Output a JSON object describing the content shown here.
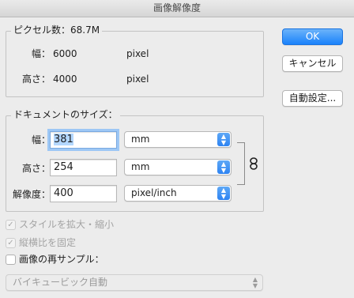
{
  "window": {
    "title": "画像解像度"
  },
  "pixel_dimensions": {
    "title": "ピクセル数：68.7M",
    "width_label": "幅：",
    "width_value": "6000",
    "width_unit": "pixel",
    "height_label": "高さ：",
    "height_value": "4000",
    "height_unit": "pixel"
  },
  "buttons": {
    "ok": "OK",
    "cancel": "キャンセル",
    "auto": "自動設定..."
  },
  "document_size": {
    "title": "ドキュメントのサイズ：",
    "width_label": "幅：",
    "width_value": "381",
    "width_unit": "mm",
    "height_label": "高さ：",
    "height_value": "254",
    "height_unit": "mm",
    "resolution_label": "解像度：",
    "resolution_value": "400",
    "resolution_unit": "pixel/inch"
  },
  "options": {
    "scale_styles": {
      "label": "スタイルを拡大・縮小",
      "checked": true,
      "enabled": false
    },
    "constrain_proportions": {
      "label": "縦横比を固定",
      "checked": true,
      "enabled": false
    },
    "resample": {
      "label": "画像の再サンプル：",
      "checked": false,
      "enabled": true
    },
    "resample_method": "バイキュービック自動"
  },
  "icons": {
    "link": "link-icon",
    "checkmark": "checkmark-icon",
    "updown": "updown-arrows-icon"
  },
  "colors": {
    "accent": "#1a82fb",
    "selection": "#b3d7ff"
  }
}
